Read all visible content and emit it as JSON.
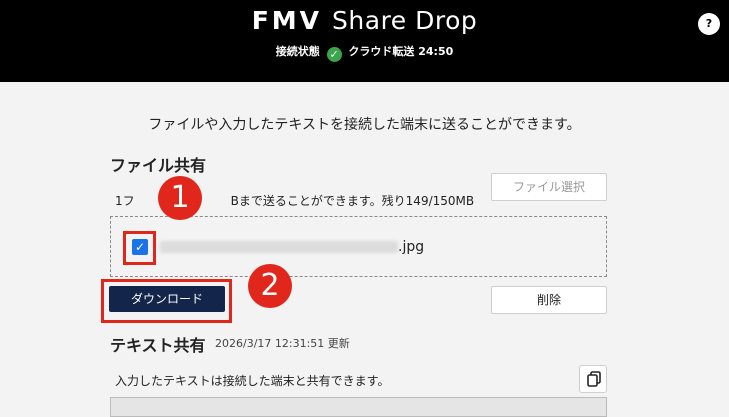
{
  "header": {
    "brand": "FMV",
    "product": "Share Drop",
    "status_label": "接続状態",
    "status_mode": "クラウド転送 24:50",
    "help_label": "?"
  },
  "intro": "ファイルや入力したテキストを接続した端末に送ることができます。",
  "file_share": {
    "title": "ファイル共有",
    "limit_text_prefix": "1フ",
    "limit_text_suffix": "Bまで送ることができます。残り149/150MB",
    "select_button": "ファイル選択",
    "file_ext": ".jpg",
    "checkbox_mark": "✓",
    "download_button": "ダウンロード",
    "delete_button": "削除"
  },
  "text_share": {
    "title": "テキスト共有",
    "updated": "2026/3/17 12:31:51 更新",
    "description": "入力したテキストは接続した端末と共有できます。"
  },
  "annotations": {
    "badge1": "1",
    "badge2": "2"
  },
  "colors": {
    "accent": "#13254a",
    "annotation": "#e1261c",
    "status_ok": "#3aa54a",
    "checkbox": "#1a73e8"
  }
}
